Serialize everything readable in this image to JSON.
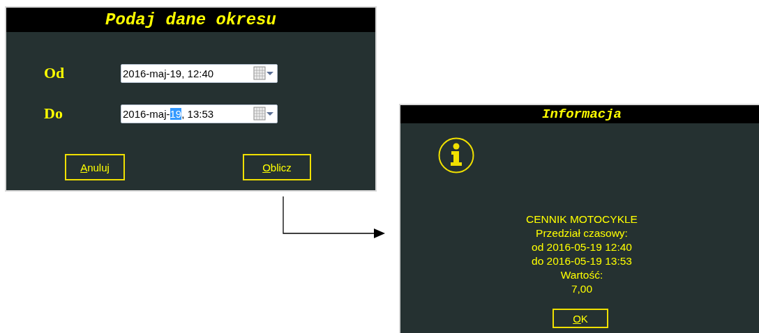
{
  "period_dialog": {
    "title": "Podaj dane okresu",
    "fields": [
      {
        "label": "Od",
        "segments": [
          {
            "text": "2016-maj-19, 12:40",
            "selected": false
          }
        ]
      },
      {
        "label": "Do",
        "segments": [
          {
            "text": "2016-maj-",
            "selected": false
          },
          {
            "text": "19",
            "selected": true
          },
          {
            "text": ", 13:53",
            "selected": false
          }
        ]
      }
    ],
    "buttons": [
      "Anuluj",
      "Oblicz"
    ]
  },
  "info_dialog": {
    "title": "Informacja",
    "message_lines": [
      "CENNIK MOTOCYKLE",
      "Przedział czasowy:",
      "od 2016-05-19 12:40",
      "do 2016-05-19 13:53",
      "Wartość:",
      "7,00"
    ],
    "button": "OK"
  }
}
